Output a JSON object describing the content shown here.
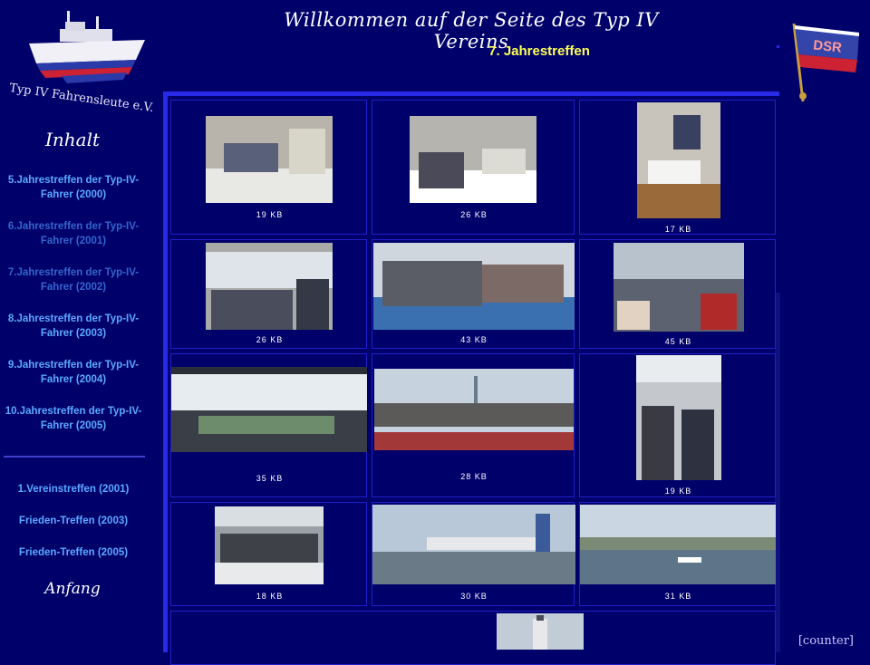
{
  "header": {
    "title": "Willkommen auf der Seite des Typ IV Vereins",
    "subtitle": "7. Jahrestreffen"
  },
  "logo": {
    "text": "Typ IV Fahrensleute e.V."
  },
  "flag": {
    "text": "DSR"
  },
  "sidebar": {
    "heading": "Inhalt",
    "links": [
      "5.Jahrestreffen der Typ-IV-Fahrer (2000)",
      "6.Jahrestreffen der Typ-IV-Fahrer (2001)",
      "7.Jahrestreffen der Typ-IV-Fahrer (2002)",
      "8.Jahrestreffen der Typ-IV-Fahrer (2003)",
      "9.Jahrestreffen der Typ-IV-Fahrer (2004)",
      "10.Jahrestreffen der Typ-IV-Fahrer (2005)"
    ],
    "links_bottom": [
      "1.Vereinstreffen (2001)",
      "Frieden-Treffen (2003)",
      "Frieden-Treffen (2005)"
    ],
    "bottom_link": "Anfang"
  },
  "gallery": {
    "sizes": [
      "19 KB",
      "26 KB",
      "17 KB",
      "26 KB",
      "43 KB",
      "45 KB",
      "35 KB",
      "28 KB",
      "19 KB",
      "18 KB",
      "30 KB",
      "31 KB"
    ]
  },
  "counter": "[counter]"
}
